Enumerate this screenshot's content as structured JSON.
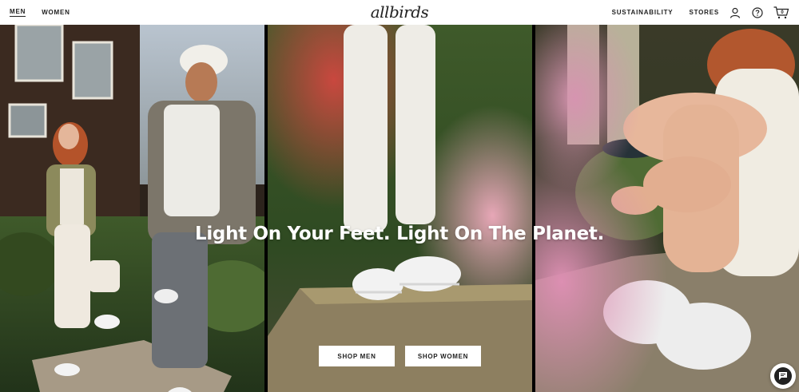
{
  "nav": {
    "left": [
      {
        "label": "MEN",
        "active": true
      },
      {
        "label": "WOMEN",
        "active": false
      }
    ],
    "logo": "allbirds",
    "right": [
      {
        "label": "SUSTAINABILITY"
      },
      {
        "label": "STORES"
      }
    ],
    "icons": [
      "account-icon",
      "help-icon",
      "cart-icon"
    ],
    "cart_count": "0"
  },
  "hero": {
    "headline": "Light On Your Feet. Light On The Planet.",
    "cta_men": "SHOP MEN",
    "cta_women": "SHOP WOMEN"
  },
  "chat": {
    "icon": "chat-icon"
  },
  "colors": {
    "text": "#212121",
    "background": "#ffffff",
    "overlay_text": "#ffffff"
  }
}
